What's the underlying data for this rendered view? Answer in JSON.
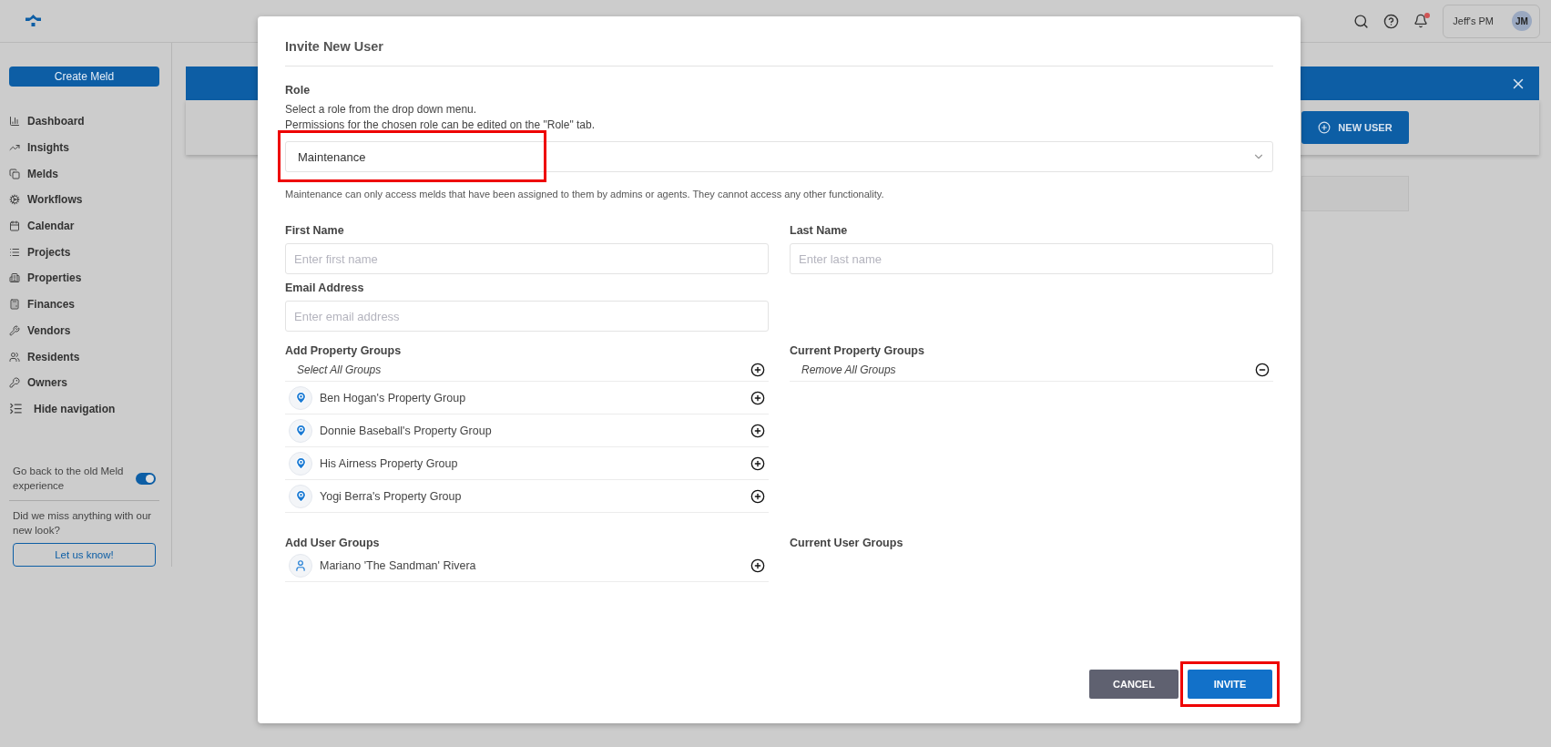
{
  "header": {
    "account": "Jeff's PM",
    "avatar": "JM",
    "notification": true
  },
  "sidebar": {
    "create_button": "Create Meld",
    "items": [
      {
        "label": "Dashboard"
      },
      {
        "label": "Insights"
      },
      {
        "label": "Melds"
      },
      {
        "label": "Workflows"
      },
      {
        "label": "Calendar"
      },
      {
        "label": "Projects"
      },
      {
        "label": "Properties"
      },
      {
        "label": "Finances"
      },
      {
        "label": "Vendors"
      },
      {
        "label": "Residents"
      },
      {
        "label": "Owners"
      },
      {
        "label": "Hide navigation"
      }
    ],
    "toggle": {
      "label": "Go back to the old Meld experience",
      "on": true
    },
    "feedback": {
      "text": "Did we miss anything with our new look?",
      "button": "Let us know!"
    }
  },
  "background": {
    "new_user_button": "NEW USER"
  },
  "modal": {
    "title": "Invite New User",
    "role": {
      "label": "Role",
      "description": [
        "Select a role from the drop down menu.",
        "Permissions for the chosen role can be edited on the \"Role\" tab."
      ],
      "value": "Maintenance",
      "highlighted": true,
      "help": "Maintenance can only access melds that have been assigned to them by admins or agents. They cannot access any other functionality."
    },
    "fields": [
      {
        "label": "First Name",
        "placeholder": "Enter first name"
      },
      {
        "label": "Last Name",
        "placeholder": "Enter last name"
      },
      {
        "label": "Email Address",
        "placeholder": "Enter email address"
      }
    ],
    "property_groups": {
      "add_label": "Add Property Groups",
      "select_all": "Select All Groups",
      "current_label": "Current Property Groups",
      "remove_all": "Remove All Groups",
      "items": [
        "Ben Hogan's Property Group",
        "Donnie Baseball's Property Group",
        "His Airness Property Group",
        "Yogi Berra's Property Group"
      ]
    },
    "user_groups": {
      "add_label": "Add User Groups",
      "current_label": "Current User Groups",
      "items": [
        "Mariano 'The Sandman' Rivera"
      ]
    },
    "buttons": {
      "cancel": "CANCEL",
      "invite": "INVITE",
      "invite_highlighted": true
    }
  }
}
